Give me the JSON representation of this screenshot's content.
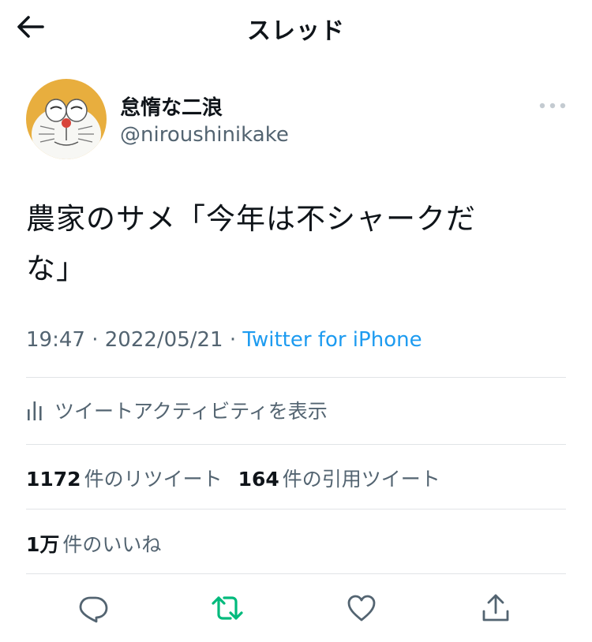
{
  "header": {
    "title": "スレッド",
    "back_icon": "arrow-left-icon"
  },
  "user": {
    "display_name": "怠惰な二浪",
    "handle": "@niroushinikake"
  },
  "tweet": {
    "text_line1": "農家のサメ「今年は不シャークだ",
    "text_line2": "な」",
    "time": "19:47",
    "date": "2022/05/21",
    "source": "Twitter for iPhone"
  },
  "activity": {
    "label": "ツイートアクティビティを表示"
  },
  "stats": {
    "retweets_count": "1172",
    "retweets_label": "件のリツイート",
    "quotes_count": "164",
    "quotes_label": "件の引用ツイート",
    "likes_count": "1万",
    "likes_label": "件のいいね"
  },
  "colors": {
    "text": "#0f1419",
    "secondary": "#536471",
    "link": "#1d9bf0",
    "retweet_green": "#00ba7c",
    "divider": "#e1e4e7"
  }
}
